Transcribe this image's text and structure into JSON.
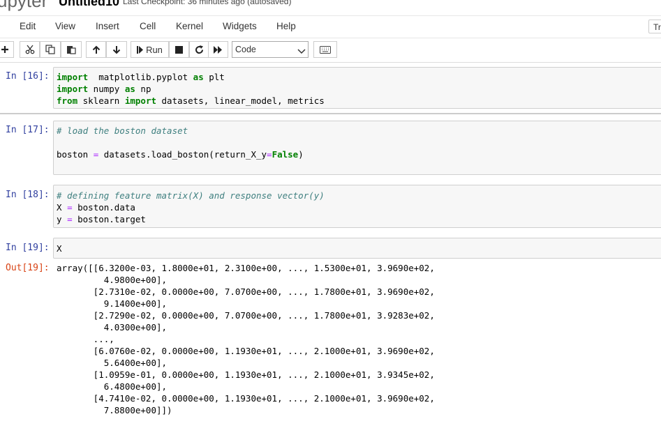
{
  "header": {
    "logo_text": "upyter",
    "notebook_name": "Untitled10",
    "checkpoint_text": "Last Checkpoint: 36 minutes ago  (autosaved)"
  },
  "menubar": {
    "items": [
      "Edit",
      "View",
      "Insert",
      "Cell",
      "Kernel",
      "Widgets",
      "Help"
    ],
    "trusted_label": "Tr"
  },
  "toolbar": {
    "run_label": "Run",
    "cell_type": "Code",
    "icons": [
      "plus-icon",
      "cut-icon",
      "copy-icon",
      "paste-icon",
      "arrow-up-icon",
      "arrow-down-icon",
      "run-icon",
      "stop-icon",
      "restart-icon",
      "fast-forward-icon",
      "keyboard-icon"
    ]
  },
  "cells": [
    {
      "prompt": "In [16]:",
      "lines": [
        [
          [
            "kw",
            "import"
          ],
          [
            "",
            "  matplotlib.pyplot "
          ],
          [
            "kw",
            "as"
          ],
          [
            "",
            " plt"
          ]
        ],
        [
          [
            "kw",
            "import"
          ],
          [
            "",
            " numpy "
          ],
          [
            "kw",
            "as"
          ],
          [
            "",
            " np"
          ]
        ],
        [
          [
            "kw",
            "from"
          ],
          [
            "",
            " sklearn "
          ],
          [
            "kw",
            "import"
          ],
          [
            "",
            " datasets, linear_model, metrics"
          ]
        ]
      ]
    },
    {
      "prompt": "In [17]:",
      "lines": [
        [
          [
            "cm",
            "# load the boston dataset"
          ]
        ],
        [
          [
            "",
            ""
          ]
        ],
        [
          [
            "",
            "boston "
          ],
          [
            "op",
            "="
          ],
          [
            "",
            " datasets.load_boston(return_X_y"
          ],
          [
            "op",
            "="
          ],
          [
            "bool",
            "False"
          ],
          [
            "",
            ")"
          ]
        ]
      ]
    },
    {
      "prompt": "In [18]:",
      "lines": [
        [
          [
            "cm",
            "# defining feature matrix(X) and response vector(y)"
          ]
        ],
        [
          [
            "",
            "X "
          ],
          [
            "op",
            "="
          ],
          [
            "",
            " boston.data"
          ]
        ],
        [
          [
            "",
            "y "
          ],
          [
            "op",
            "="
          ],
          [
            "",
            " boston.target"
          ]
        ]
      ]
    },
    {
      "prompt": "In [19]:",
      "lines": [
        [
          [
            "",
            "X"
          ]
        ]
      ]
    }
  ],
  "output": {
    "prompt": "Out[19]:",
    "lines": [
      "array([[6.3200e-03, 1.8000e+01, 2.3100e+00, ..., 1.5300e+01, 3.9690e+02,",
      "         4.9800e+00],",
      "       [2.7310e-02, 0.0000e+00, 7.0700e+00, ..., 1.7800e+01, 3.9690e+02,",
      "         9.1400e+00],",
      "       [2.7290e-02, 0.0000e+00, 7.0700e+00, ..., 1.7800e+01, 3.9283e+02,",
      "         4.0300e+00],",
      "       ...,",
      "       [6.0760e-02, 0.0000e+00, 1.1930e+01, ..., 2.1000e+01, 3.9690e+02,",
      "         5.6400e+00],",
      "       [1.0959e-01, 0.0000e+00, 1.1930e+01, ..., 2.1000e+01, 3.9345e+02,",
      "         6.4800e+00],",
      "       [4.7410e-02, 0.0000e+00, 1.1930e+01, ..., 2.1000e+01, 3.9690e+02,",
      "         7.8800e+00]])"
    ]
  },
  "colors": {
    "prompt_in": "#303F9F",
    "prompt_out": "#D84315",
    "keyword": "#008000",
    "operator": "#AA22FF",
    "comment": "#408080"
  }
}
